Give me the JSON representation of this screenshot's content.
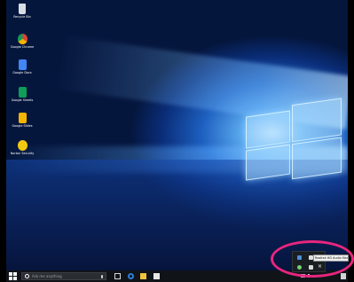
{
  "desktop_icons": [
    {
      "label": "Recycle Bin",
      "icon": "recycle-bin-icon",
      "color": "#d7dde4"
    },
    {
      "label": "Google Chrome",
      "icon": "chrome-icon",
      "color": "#db4437"
    },
    {
      "label": "Google Docs",
      "icon": "google-docs-icon",
      "color": "#4285f4"
    },
    {
      "label": "Google Sheets",
      "icon": "google-sheets-icon",
      "color": "#0f9d58"
    },
    {
      "label": "Google Slides",
      "icon": "google-slides-icon",
      "color": "#f4b400"
    },
    {
      "label": "Norton Security",
      "icon": "norton-icon",
      "color": "#f2c811"
    }
  ],
  "taskbar": {
    "search_placeholder": "Ask me anything",
    "pinned": [
      "task-view-icon",
      "edge-icon",
      "file-explorer-icon",
      "store-icon"
    ],
    "clock_time": "",
    "clock_date": ""
  },
  "tray_flyout": {
    "tooltip": "Realtek HD Audio Manager",
    "icons": [
      "network-app-icon",
      "audio-manager-icon",
      "shield-app-icon",
      "app-icon",
      "close-icon"
    ]
  },
  "colors": {
    "highlight": "#e8267e",
    "taskbar": "#101418"
  }
}
